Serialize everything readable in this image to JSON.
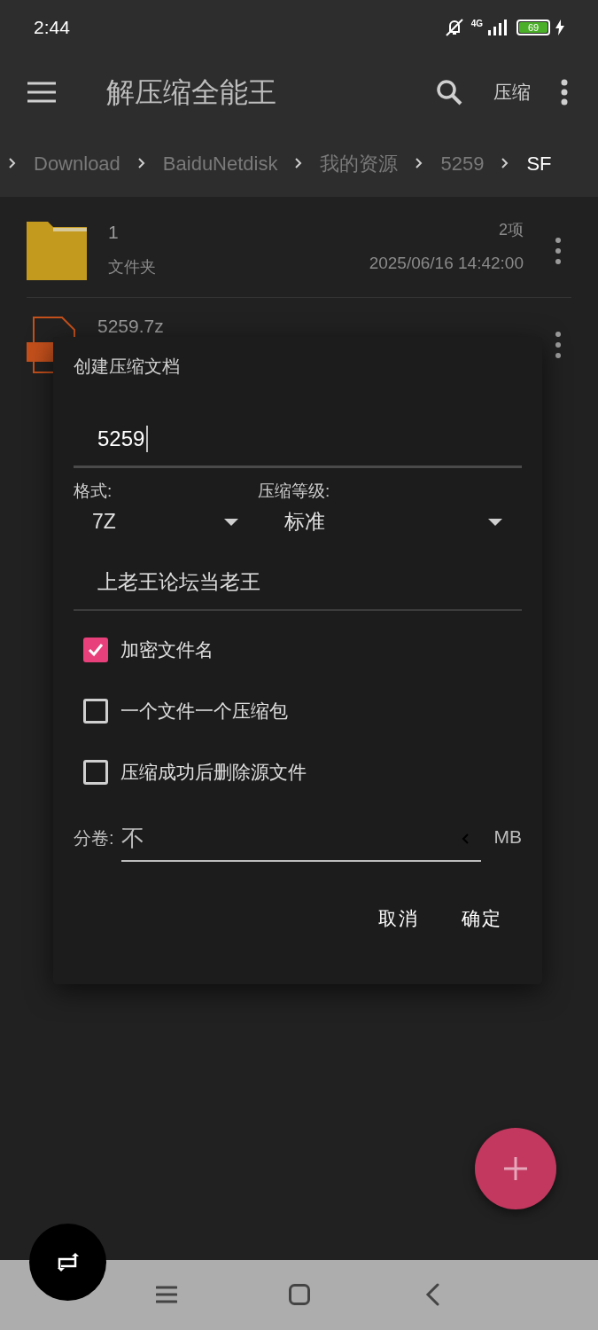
{
  "status_bar": {
    "time": "2:44",
    "network": "4G",
    "battery": "69"
  },
  "app_bar": {
    "title": "解压缩全能王",
    "action": "压缩"
  },
  "breadcrumb": [
    {
      "label": "Download",
      "selected": false
    },
    {
      "label": "BaiduNetdisk",
      "selected": false
    },
    {
      "label": "我的资源",
      "selected": false
    },
    {
      "label": "5259",
      "selected": false
    },
    {
      "label": "SF",
      "selected": true
    }
  ],
  "files": [
    {
      "kind": "folder",
      "name": "1",
      "subtitle": "文件夹",
      "count": "2项",
      "date": "2025/06/16 14:42:00"
    },
    {
      "kind": "archive",
      "name": "5259.7z"
    }
  ],
  "dialog": {
    "title": "创建压缩文档",
    "archive_name": "5259",
    "format": {
      "label": "格式:",
      "value": "7Z"
    },
    "level": {
      "label": "压缩等级:",
      "value": "标准"
    },
    "password": "上老王论坛当老王",
    "options": [
      {
        "label": "加密文件名",
        "checked": true
      },
      {
        "label": "一个文件一个压缩包",
        "checked": false
      },
      {
        "label": "压缩成功后删除源文件",
        "checked": false
      }
    ],
    "split": {
      "label": "分卷:",
      "value": "不",
      "unit": "MB"
    },
    "buttons": [
      "取消",
      "确定"
    ]
  }
}
